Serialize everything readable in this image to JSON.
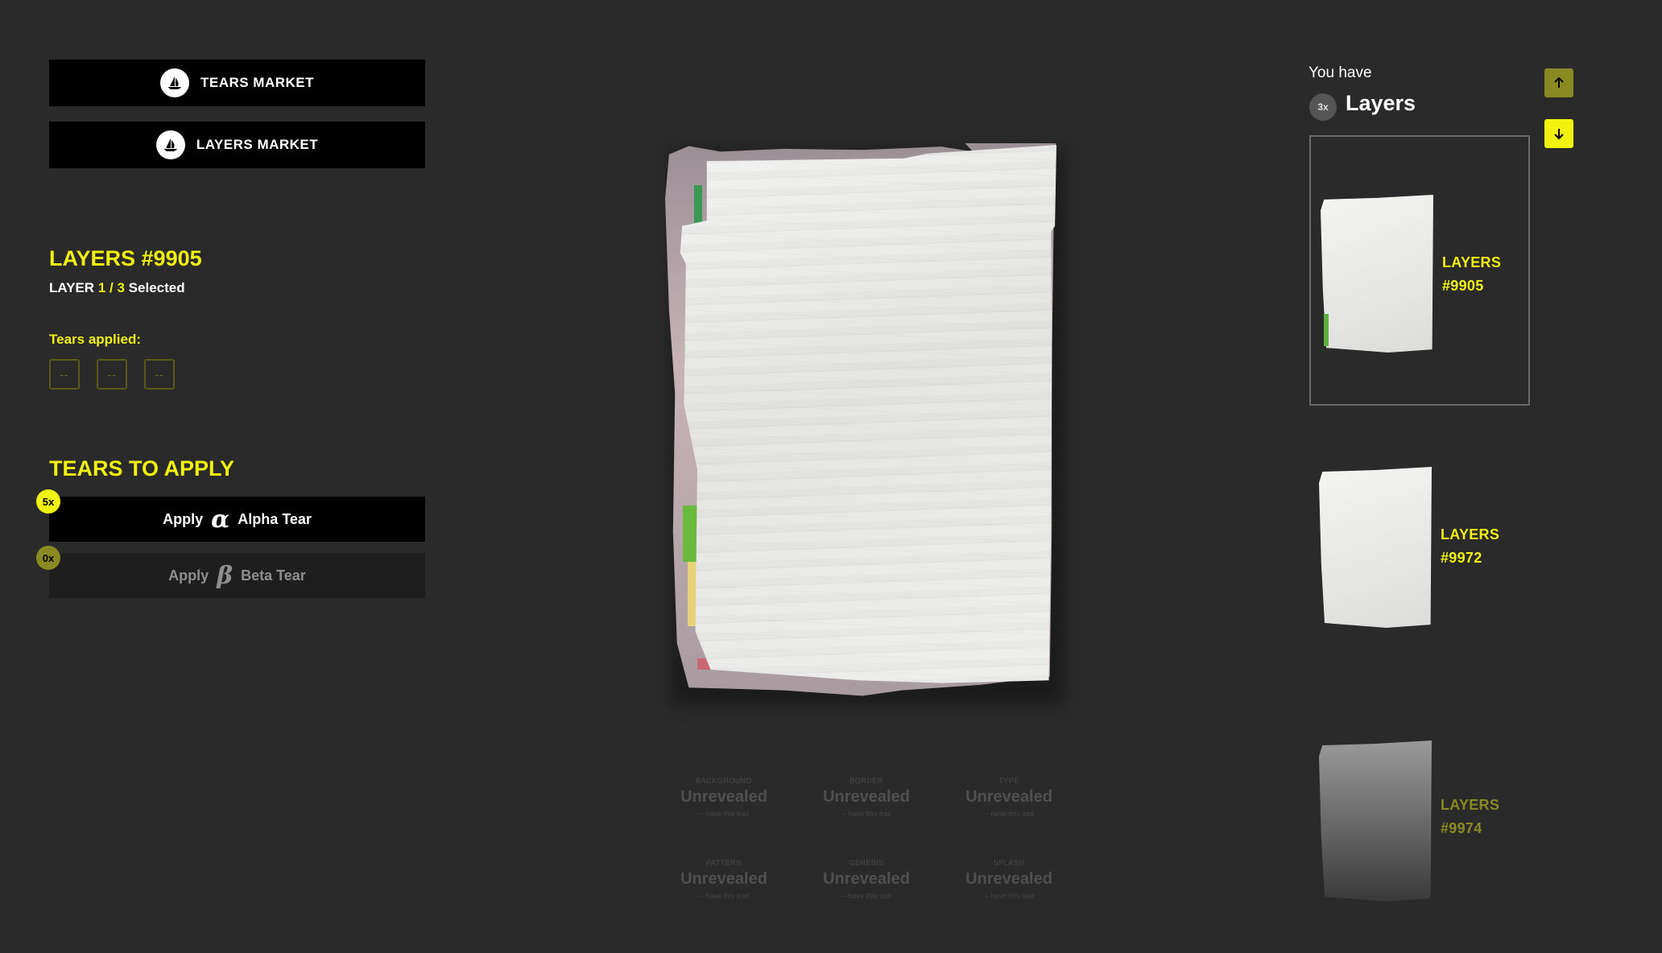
{
  "left_panel": {
    "tears_market_label": "TEARS MARKET",
    "layers_market_label": "LAYERS MARKET",
    "layer_title": "LAYERS #9905",
    "layer_selection": {
      "prefix": "LAYER",
      "current": "1",
      "separator": "/",
      "total": "3",
      "suffix": "Selected"
    },
    "tears_applied_label": "Tears applied:",
    "tear_slots": [
      "--",
      "--",
      "--"
    ],
    "tears_to_apply_title": "TEARS TO APPLY",
    "apply_buttons": [
      {
        "count": "5x",
        "prefix": "Apply",
        "symbol": "α",
        "name": "Alpha Tear",
        "enabled": true
      },
      {
        "count": "0x",
        "prefix": "Apply",
        "symbol": "β",
        "name": "Beta Tear",
        "enabled": false
      }
    ]
  },
  "traits": [
    {
      "name": "BACKGROUND",
      "value": "Unrevealed",
      "sub": "-- have this trait"
    },
    {
      "name": "BORDER",
      "value": "Unrevealed",
      "sub": "-- have this trait"
    },
    {
      "name": "TYPE",
      "value": "Unrevealed",
      "sub": "-- have this trait"
    },
    {
      "name": "PATTERN",
      "value": "Unrevealed",
      "sub": "-- have this trait"
    },
    {
      "name": "GENESIS",
      "value": "Unrevealed",
      "sub": "-- have this trait"
    },
    {
      "name": "SPLASH",
      "value": "Unrevealed",
      "sub": "-- have this trait"
    }
  ],
  "right_panel": {
    "you_have_label": "You have",
    "count_badge": "3x",
    "collection_label": "Layers",
    "items": [
      {
        "line1": "LAYERS",
        "line2": "#9905",
        "selected": true
      },
      {
        "line1": "LAYERS",
        "line2": "#9972",
        "selected": false
      },
      {
        "line1": "LAYERS",
        "line2": "#9974",
        "selected": false
      }
    ]
  },
  "colors": {
    "background": "#2a2a2a",
    "accent_yellow": "#f2f20f",
    "muted_olive": "#8a8a22",
    "button_black": "#000000"
  },
  "icons": {
    "market_logo": "opensea-ship-icon",
    "scroll_up": "arrow-up-icon",
    "scroll_down": "arrow-down-icon"
  }
}
